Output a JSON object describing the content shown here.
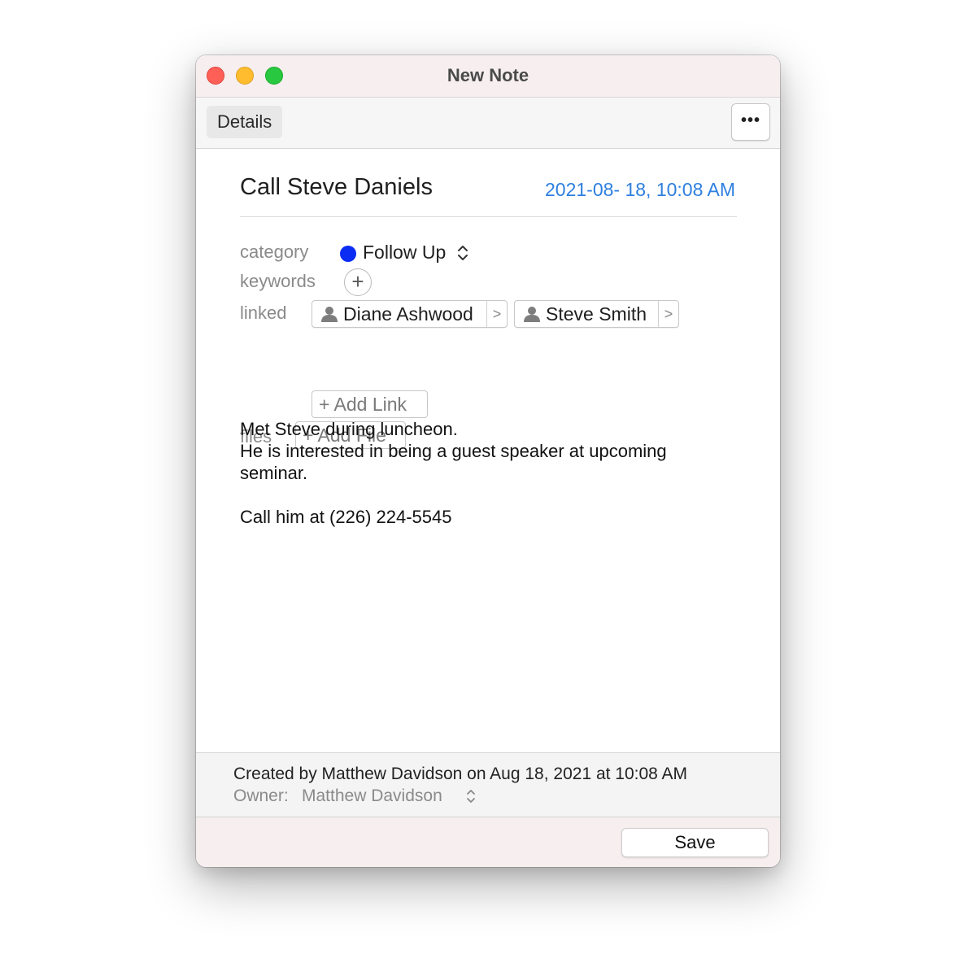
{
  "window": {
    "title": "New Note"
  },
  "toolbar": {
    "details_tab": "Details",
    "more_label": "•••"
  },
  "note": {
    "title": "Call Steve Daniels",
    "date": "2021-08- 18, 10:08 AM",
    "category_label": "category",
    "category_value": "Follow Up",
    "category_color": "#0b2cf2",
    "keywords_label": "keywords",
    "keywords_add": "+",
    "linked_label": "linked",
    "linked": [
      {
        "name": "Diane Ashwood"
      },
      {
        "name": "Steve Smith"
      }
    ],
    "add_link": "+ Add Link",
    "files_label": "files",
    "add_file": "+ Add File",
    "body": [
      "Met Steve during luncheon.",
      "He is interested in being a guest speaker at upcoming seminar.",
      "",
      "Call him at (226) 224-5545"
    ]
  },
  "footer": {
    "created": "Created by Matthew Davidson on Aug 18, 2021 at 10:08 AM",
    "owner_label": "Owner:",
    "owner_value": "Matthew Davidson",
    "save_label": "Save"
  }
}
